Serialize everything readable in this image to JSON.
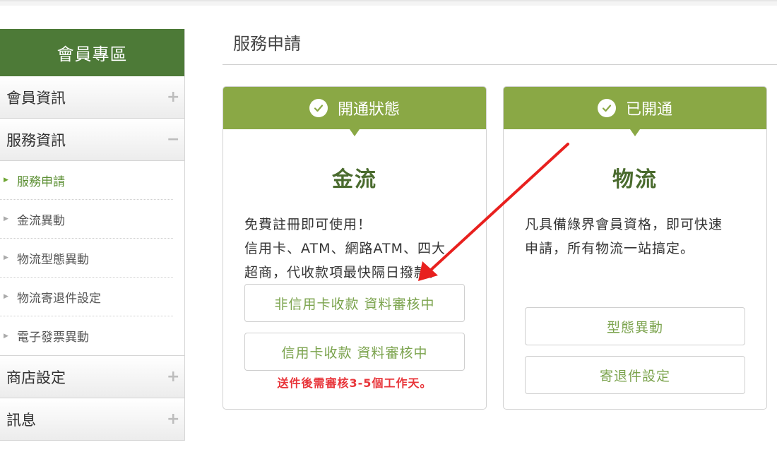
{
  "sidebar": {
    "header": "會員專區",
    "categories": [
      {
        "label": "會員資訊",
        "icon": "+"
      },
      {
        "label": "服務資訊",
        "icon": "−"
      },
      {
        "label": "商店設定",
        "icon": "+"
      },
      {
        "label": "訊息",
        "icon": "+"
      }
    ],
    "sub_items": [
      {
        "label": "服務申請"
      },
      {
        "label": "金流異動"
      },
      {
        "label": "物流型態異動"
      },
      {
        "label": "物流寄退件設定"
      },
      {
        "label": "電子發票異動"
      }
    ]
  },
  "main": {
    "title": "服務申請",
    "cards": [
      {
        "status": "開通狀態",
        "title": "金流",
        "desc_lines": [
          "免費註冊即可使用！",
          "信用卡、ATM、網路ATM、四大",
          "超商，代收款項最快隔日撥款。"
        ],
        "buttons": [
          "非信用卡收款 資料審核中",
          "信用卡收款 資料審核中"
        ],
        "note": "送件後需審核3-5個工作天。"
      },
      {
        "status": "已開通",
        "title": "物流",
        "desc_lines": [
          "凡具備綠界會員資格，即可快速",
          "申請，所有物流一站搞定。"
        ],
        "buttons": [
          "型態異動",
          "寄退件設定"
        ]
      }
    ]
  },
  "colors": {
    "sidebar_header": "#4d7a37",
    "card_header": "#8aa845",
    "accent_text": "#7ba34d",
    "note_red": "#e8353a",
    "annotation_arrow": "#e8201e"
  }
}
